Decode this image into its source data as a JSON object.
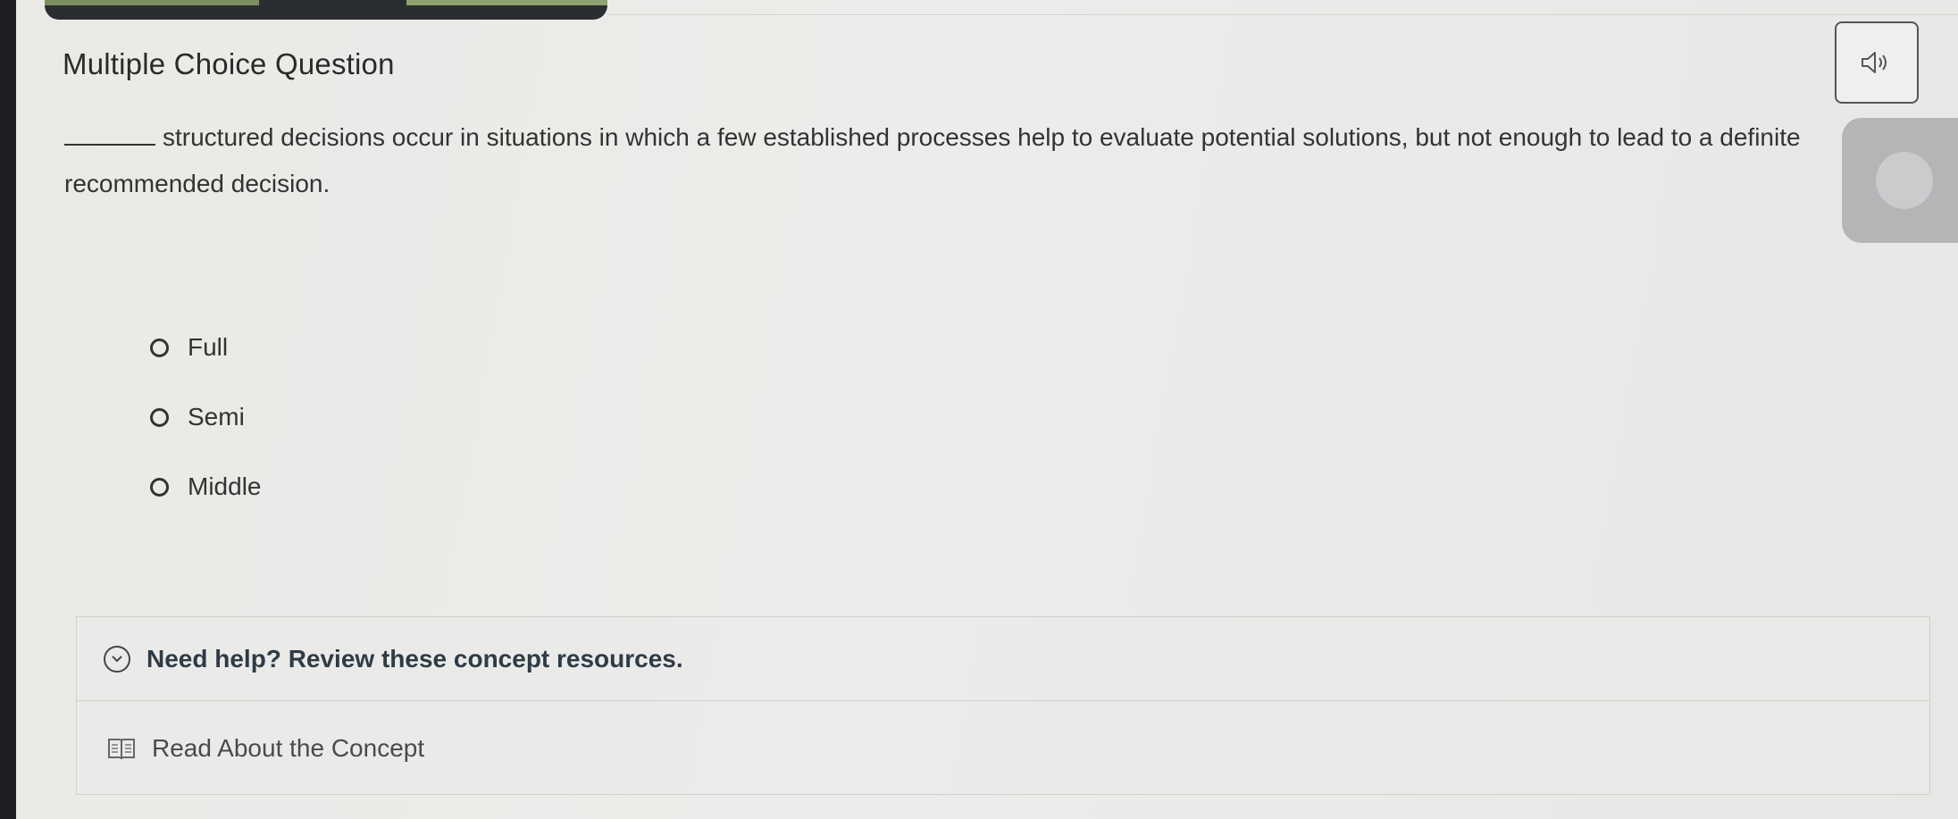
{
  "question": {
    "type_label": "Multiple Choice Question",
    "text": "structured decisions occur in situations in which a few established processes help to evaluate potential solutions, but not enough to lead to a definite recommended decision."
  },
  "options": [
    {
      "label": "Full"
    },
    {
      "label": "Semi"
    },
    {
      "label": "Middle"
    }
  ],
  "help": {
    "title": "Need help? Review these concept resources.",
    "resources": [
      {
        "label": "Read About the Concept",
        "icon": "book-icon"
      }
    ]
  },
  "toolbar": {
    "audio_icon": "speaker-icon"
  }
}
